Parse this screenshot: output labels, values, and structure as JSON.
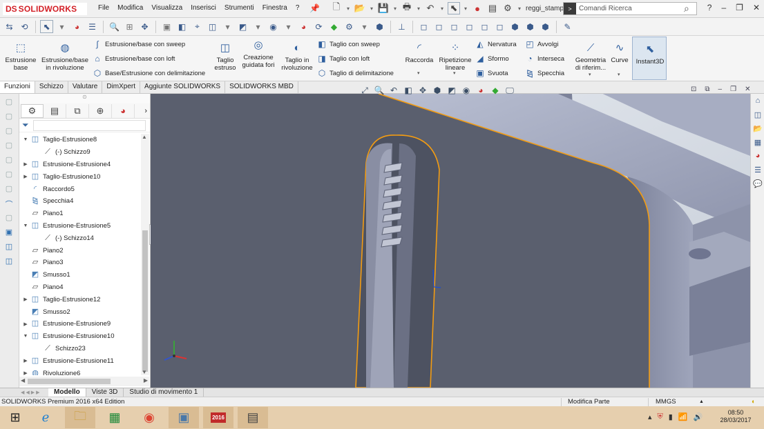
{
  "app": {
    "brand": "SOLIDWORKS",
    "brand_prefix": "DS"
  },
  "menu": [
    "File",
    "Modifica",
    "Visualizza",
    "Inserisci",
    "Strumenti",
    "Finestra",
    "?"
  ],
  "document": {
    "name": "reggi_stampo *"
  },
  "search": {
    "placeholder": "Comandi Ricerca"
  },
  "ribbon": {
    "estrusione_base": "Estrusione base",
    "estrusione_rivoluzione": "Estrusione/base in rivoluzione",
    "sweep": "Estrusione/base con sweep",
    "loft": "Estrusione/base con loft",
    "delimitazione": "Base/Estrusione con delimitazione",
    "taglio_estruso": "Taglio estruso",
    "creazione_fori": "Creazione guidata fori",
    "taglio_rivoluzione": "Taglio in rivoluzione",
    "taglio_sweep": "Taglio con sweep",
    "taglio_loft": "Taglio con loft",
    "taglio_delimitazione": "Taglio di delimitazione",
    "raccorda": "Raccorda",
    "ripetizione_lineare": "Ripetizione lineare",
    "nervatura": "Nervatura",
    "sformo": "Sformo",
    "svuota": "Svuota",
    "avvolgi": "Avvolgi",
    "interseca": "Interseca",
    "specchia": "Specchia",
    "geometria": "Geometria di riferim...",
    "curve": "Curve",
    "instant3d": "Instant3D"
  },
  "cm_tabs": [
    "Funzioni",
    "Schizzo",
    "Valutare",
    "DimXpert",
    "Aggiunte SOLIDWORKS",
    "SOLIDWORKS MBD"
  ],
  "tree": [
    {
      "label": "Taglio-Estrusione8",
      "expander": "▼",
      "icon": "cut-extrude-icon",
      "indent": 0
    },
    {
      "label": "(-) Schizzo9",
      "expander": "",
      "icon": "sketch-icon",
      "indent": 1
    },
    {
      "label": "Estrusione-Estrusione4",
      "expander": "▶",
      "icon": "boss-extrude-icon",
      "indent": 0
    },
    {
      "label": "Taglio-Estrusione10",
      "expander": "▶",
      "icon": "cut-extrude-icon",
      "indent": 0
    },
    {
      "label": "Raccordo5",
      "expander": "",
      "icon": "fillet-icon",
      "indent": 0
    },
    {
      "label": "Specchia4",
      "expander": "",
      "icon": "mirror-icon",
      "indent": 0
    },
    {
      "label": "Piano1",
      "expander": "",
      "icon": "plane-icon",
      "indent": 0
    },
    {
      "label": "Estrusione-Estrusione5",
      "expander": "▼",
      "icon": "boss-extrude-icon",
      "indent": 0
    },
    {
      "label": "(-) Schizzo14",
      "expander": "",
      "icon": "sketch-icon",
      "indent": 1
    },
    {
      "label": "Piano2",
      "expander": "",
      "icon": "plane-icon",
      "indent": 0
    },
    {
      "label": "Piano3",
      "expander": "",
      "icon": "plane-icon",
      "indent": 0
    },
    {
      "label": "Smusso1",
      "expander": "",
      "icon": "chamfer-icon",
      "indent": 0
    },
    {
      "label": "Piano4",
      "expander": "",
      "icon": "plane-icon",
      "indent": 0
    },
    {
      "label": "Taglio-Estrusione12",
      "expander": "▶",
      "icon": "cut-extrude-icon",
      "indent": 0
    },
    {
      "label": "Smusso2",
      "expander": "",
      "icon": "chamfer-icon",
      "indent": 0
    },
    {
      "label": "Estrusione-Estrusione9",
      "expander": "▶",
      "icon": "boss-extrude-icon",
      "indent": 0
    },
    {
      "label": "Estrusione-Estrusione10",
      "expander": "▼",
      "icon": "boss-extrude-icon",
      "indent": 0
    },
    {
      "label": "Schizzo23",
      "expander": "",
      "icon": "sketch-icon",
      "indent": 1
    },
    {
      "label": "Estrusione-Estrusione11",
      "expander": "▶",
      "icon": "boss-extrude-icon",
      "indent": 0
    },
    {
      "label": "Rivoluzione6",
      "expander": "▶",
      "icon": "revolve-icon",
      "indent": 0
    }
  ],
  "bottom_tabs": [
    "Modello",
    "Viste 3D",
    "Studio di movimento 1"
  ],
  "status": {
    "edition": "SOLIDWORKS Premium 2016 x64 Edition",
    "mode": "Modifica Parte",
    "units": "MMGS"
  },
  "taskbar": {
    "sw_label": "2016"
  },
  "clock": {
    "time": "08:50",
    "date": "28/03/2017"
  },
  "colors": {
    "accent": "#d31f26",
    "highlight": "#f39c12",
    "part_face": "#5a5f6e"
  }
}
